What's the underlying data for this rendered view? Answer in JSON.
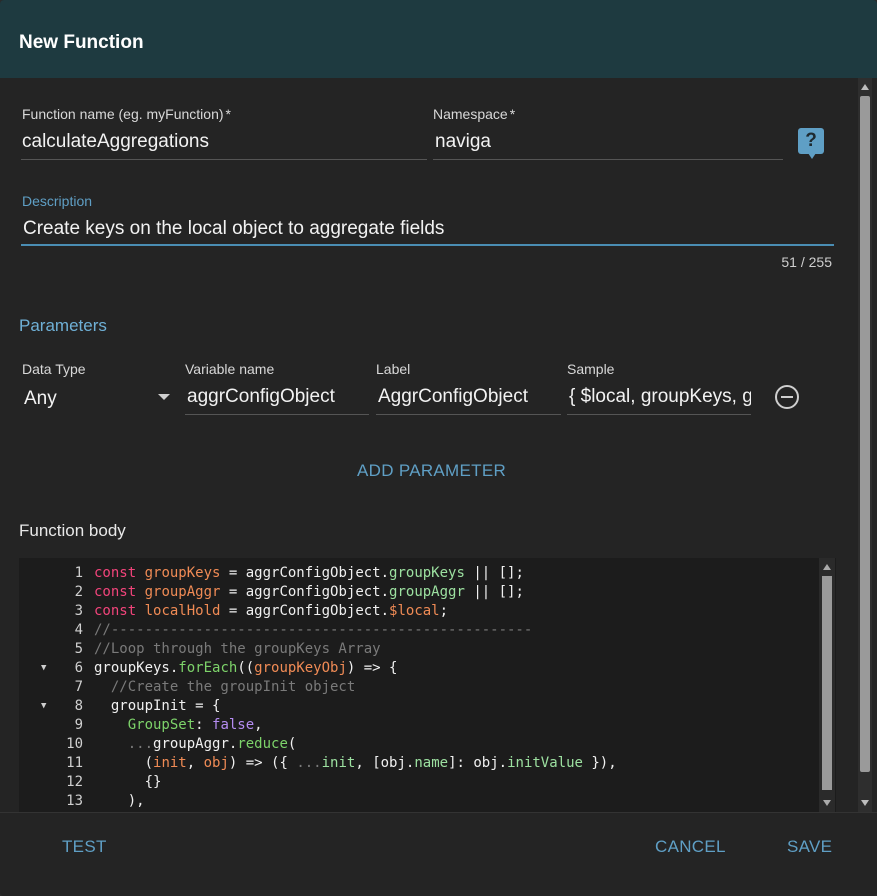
{
  "dialog": {
    "title": "New Function"
  },
  "form": {
    "function_name": {
      "label": "Function name (eg. myFunction)",
      "required_mark": "*",
      "value": "calculateAggregations"
    },
    "namespace": {
      "label": "Namespace",
      "required_mark": "*",
      "value": "naviga"
    },
    "help_icon": "question-icon",
    "description": {
      "label": "Description",
      "value": "Create keys on the local object to aggregate fields",
      "counter": "51 / 255"
    }
  },
  "parameters": {
    "title": "Parameters",
    "headers": {
      "data_type": "Data Type",
      "variable_name": "Variable name",
      "label": "Label",
      "sample": "Sample"
    },
    "rows": [
      {
        "data_type": "Any",
        "variable_name": "aggrConfigObject",
        "label": "AggrConfigObject",
        "sample": "{ $local, groupKeys, groupAggr }"
      }
    ],
    "add_button": "ADD PARAMETER"
  },
  "function_body": {
    "title": "Function body",
    "lines": [
      {
        "n": "1",
        "fold": "",
        "html": "<span class='kw'>const</span> <span class='var'>groupKeys</span> = aggrConfigObject.<span class='prop'>groupKeys</span> || [];"
      },
      {
        "n": "2",
        "fold": "",
        "html": "<span class='kw'>const</span> <span class='var'>groupAggr</span> = aggrConfigObject.<span class='prop'>groupAggr</span> || [];"
      },
      {
        "n": "3",
        "fold": "",
        "html": "<span class='kw'>const</span> <span class='var'>localHold</span> = aggrConfigObject.<span class='var'>$local</span>;"
      },
      {
        "n": "4",
        "fold": "",
        "html": "<span class='cm'>//--------------------------------------------------</span>"
      },
      {
        "n": "5",
        "fold": "",
        "html": "<span class='cm'>//Loop through the groupKeys Array</span>"
      },
      {
        "n": "6",
        "fold": "▼",
        "html": "groupKeys.<span class='fn'>forEach</span>((<span class='var'>groupKeyObj</span>) =&gt; {"
      },
      {
        "n": "7",
        "fold": "",
        "html": "  <span class='cm'>//Create the groupInit object</span>"
      },
      {
        "n": "8",
        "fold": "▼",
        "html": "  groupInit = {"
      },
      {
        "n": "9",
        "fold": "",
        "html": "    <span class='fn'>GroupSet</span>: <span class='bool'>false</span>,"
      },
      {
        "n": "10",
        "fold": "",
        "html": "    <span class='spread'>...</span>groupAggr.<span class='fn'>reduce</span>("
      },
      {
        "n": "11",
        "fold": "",
        "html": "      (<span class='var'>init</span>, <span class='var'>obj</span>) =&gt; ({ <span class='spread'>...</span><span class='prop'>init</span>, [obj.<span class='prop'>name</span>]: obj.<span class='prop'>initValue</span> }),"
      },
      {
        "n": "12",
        "fold": "",
        "html": "      {}"
      },
      {
        "n": "13",
        "fold": "",
        "html": "    ),"
      }
    ]
  },
  "footer": {
    "test": "TEST",
    "cancel": "CANCEL",
    "save": "SAVE"
  }
}
